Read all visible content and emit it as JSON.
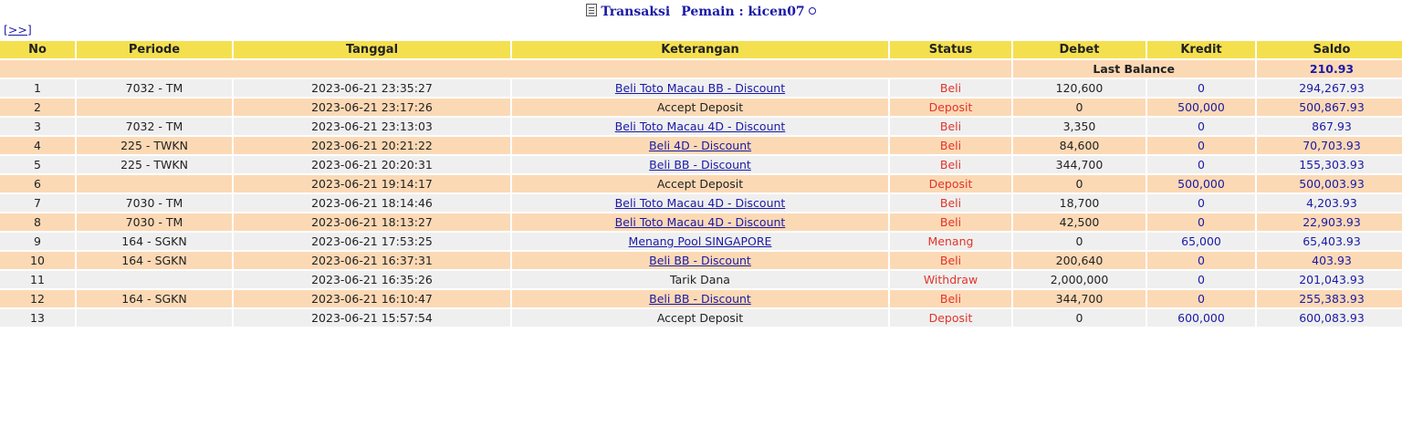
{
  "header": {
    "title_prefix": "Transaksi",
    "title_player": "Pemain : kicen07",
    "nav_link": "[>>]"
  },
  "table": {
    "columns": [
      "No",
      "Periode",
      "Tanggal",
      "Keterangan",
      "Status",
      "Debet",
      "Kredit",
      "Saldo"
    ],
    "last_balance_label": "Last Balance",
    "last_balance_value": "210.93",
    "rows": [
      {
        "no": "1",
        "periode": "7032 - TM",
        "tanggal": "2023-06-21 23:35:27",
        "keterangan": "Beli Toto Macau BB - Discount",
        "link": true,
        "status": "Beli",
        "debet": "120,600",
        "kredit": "0",
        "saldo": "294,267.93"
      },
      {
        "no": "2",
        "periode": "",
        "tanggal": "2023-06-21 23:17:26",
        "keterangan": "Accept Deposit",
        "link": false,
        "status": "Deposit",
        "debet": "0",
        "kredit": "500,000",
        "saldo": "500,867.93"
      },
      {
        "no": "3",
        "periode": "7032 - TM",
        "tanggal": "2023-06-21 23:13:03",
        "keterangan": "Beli Toto Macau 4D - Discount",
        "link": true,
        "status": "Beli",
        "debet": "3,350",
        "kredit": "0",
        "saldo": "867.93"
      },
      {
        "no": "4",
        "periode": "225 - TWKN",
        "tanggal": "2023-06-21 20:21:22",
        "keterangan": "Beli 4D - Discount",
        "link": true,
        "status": "Beli",
        "debet": "84,600",
        "kredit": "0",
        "saldo": "70,703.93"
      },
      {
        "no": "5",
        "periode": "225 - TWKN",
        "tanggal": "2023-06-21 20:20:31",
        "keterangan": "Beli BB - Discount",
        "link": true,
        "status": "Beli",
        "debet": "344,700",
        "kredit": "0",
        "saldo": "155,303.93"
      },
      {
        "no": "6",
        "periode": "",
        "tanggal": "2023-06-21 19:14:17",
        "keterangan": "Accept Deposit",
        "link": false,
        "status": "Deposit",
        "debet": "0",
        "kredit": "500,000",
        "saldo": "500,003.93"
      },
      {
        "no": "7",
        "periode": "7030 - TM",
        "tanggal": "2023-06-21 18:14:46",
        "keterangan": "Beli Toto Macau 4D - Discount",
        "link": true,
        "status": "Beli",
        "debet": "18,700",
        "kredit": "0",
        "saldo": "4,203.93"
      },
      {
        "no": "8",
        "periode": "7030 - TM",
        "tanggal": "2023-06-21 18:13:27",
        "keterangan": "Beli Toto Macau 4D - Discount",
        "link": true,
        "status": "Beli",
        "debet": "42,500",
        "kredit": "0",
        "saldo": "22,903.93"
      },
      {
        "no": "9",
        "periode": "164 - SGKN",
        "tanggal": "2023-06-21 17:53:25",
        "keterangan": "Menang Pool SINGAPORE",
        "link": true,
        "status": "Menang",
        "debet": "0",
        "kredit": "65,000",
        "saldo": "65,403.93"
      },
      {
        "no": "10",
        "periode": "164 - SGKN",
        "tanggal": "2023-06-21 16:37:31",
        "keterangan": "Beli BB - Discount",
        "link": true,
        "status": "Beli",
        "debet": "200,640",
        "kredit": "0",
        "saldo": "403.93"
      },
      {
        "no": "11",
        "periode": "",
        "tanggal": "2023-06-21 16:35:26",
        "keterangan": "Tarik Dana",
        "link": false,
        "status": "Withdraw",
        "debet": "2,000,000",
        "kredit": "0",
        "saldo": "201,043.93"
      },
      {
        "no": "12",
        "periode": "164 - SGKN",
        "tanggal": "2023-06-21 16:10:47",
        "keterangan": "Beli BB - Discount",
        "link": true,
        "status": "Beli",
        "debet": "344,700",
        "kredit": "0",
        "saldo": "255,383.93"
      },
      {
        "no": "13",
        "periode": "",
        "tanggal": "2023-06-21 15:57:54",
        "keterangan": "Accept Deposit",
        "link": false,
        "status": "Deposit",
        "debet": "0",
        "kredit": "600,000",
        "saldo": "600,083.93"
      }
    ]
  },
  "colors": {
    "header_bg": "#f4e04f",
    "row_peach": "#fcd9b5",
    "row_gray": "#efefef",
    "link_blue": "#1a1aa6",
    "status_red": "#e0352b"
  }
}
